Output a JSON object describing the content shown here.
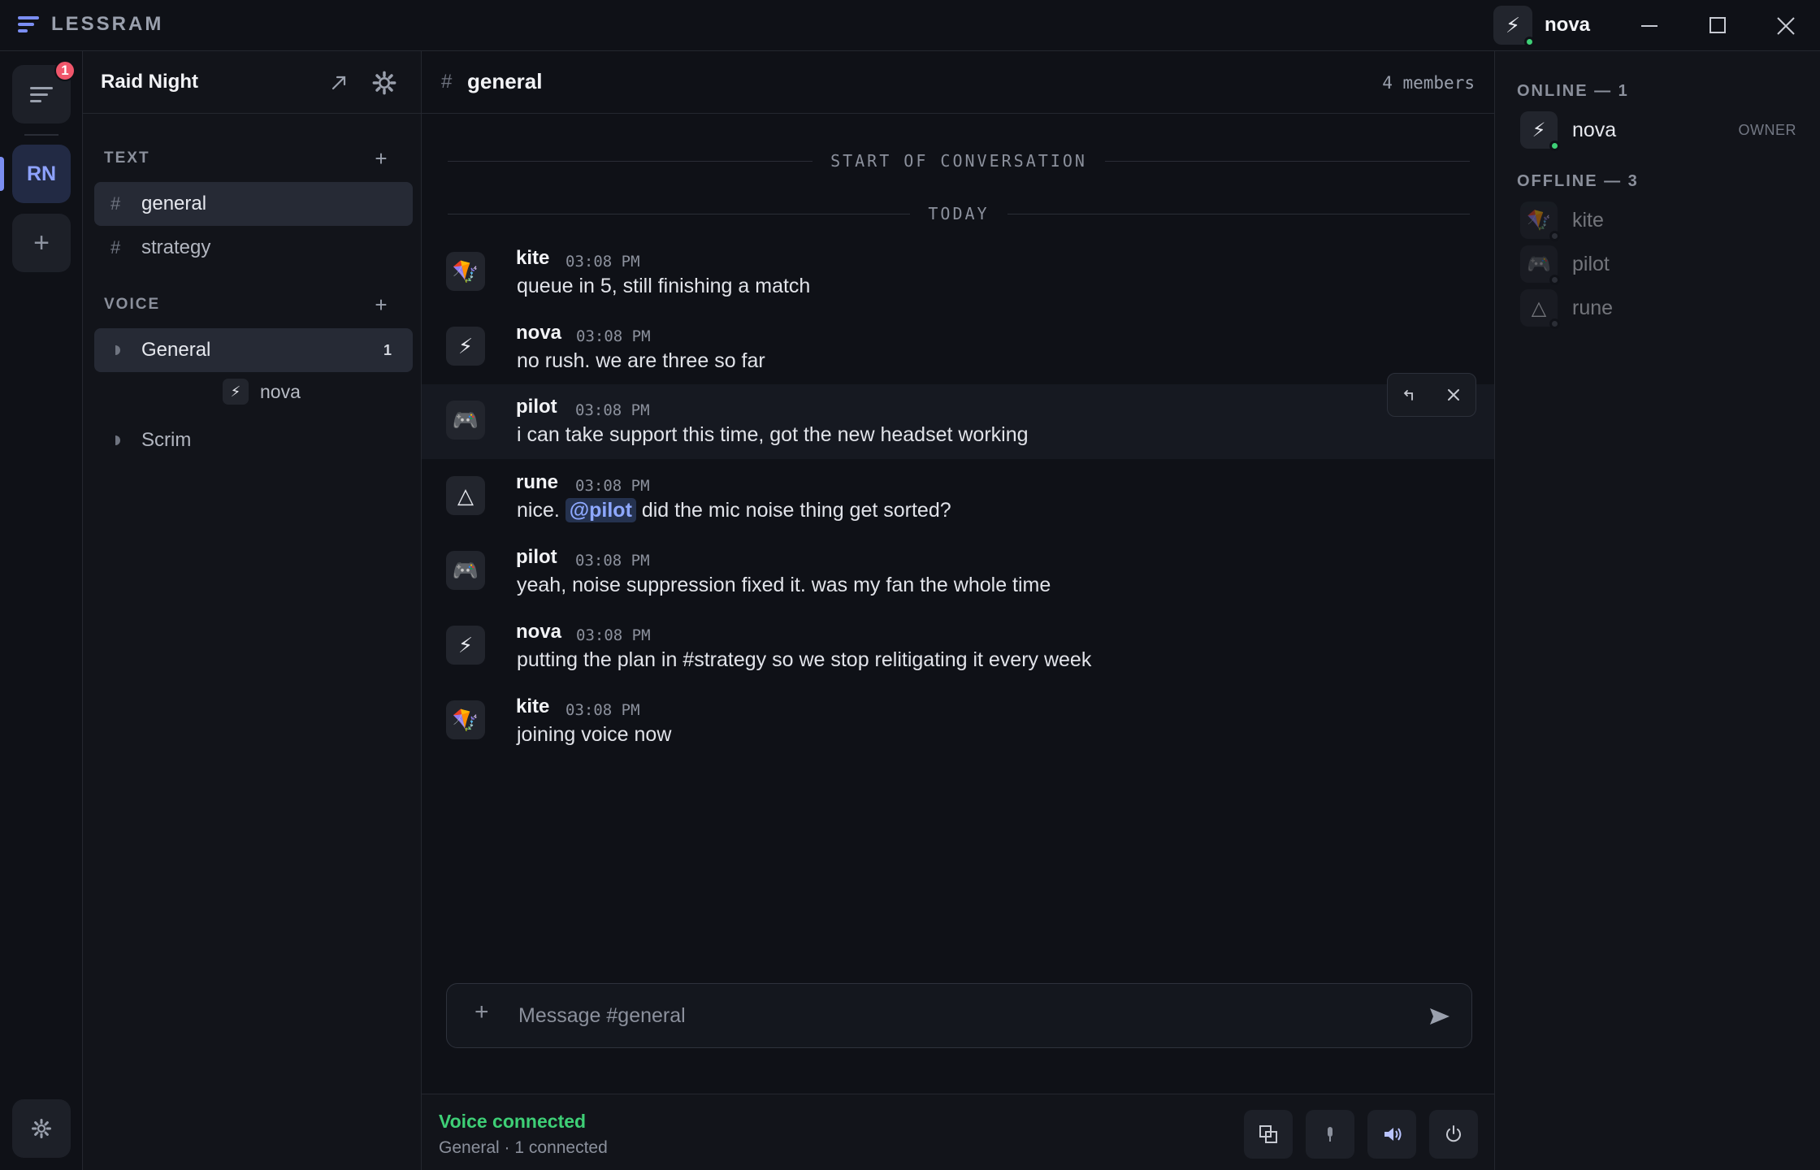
{
  "app": {
    "name": "LESSRAM"
  },
  "titlebar": {
    "user_name": "nova",
    "user_avatar_icon": "⚡",
    "accent": "#7b8ef2"
  },
  "rail": {
    "notification_count": "1",
    "server_initials": "RN",
    "add_label": "+"
  },
  "server": {
    "name": "Raid Night",
    "text_category": "TEXT",
    "voice_category": "VOICE",
    "text_channels": [
      {
        "name": "general",
        "active": true
      },
      {
        "name": "strategy",
        "active": false
      }
    ],
    "voice_channels": [
      {
        "name": "General",
        "count": "1",
        "active": true
      },
      {
        "name": "Scrim",
        "count": "",
        "active": false
      }
    ],
    "voice_members": [
      {
        "name": "nova"
      }
    ]
  },
  "chat": {
    "channel": "general",
    "members_count": "4 members",
    "start_label": "START OF CONVERSATION",
    "today_label": "TODAY",
    "messages": [
      {
        "author": "kite",
        "time": "03:08 PM",
        "text": "queue in 5, still finishing a match",
        "avatar": "🪁"
      },
      {
        "author": "nova",
        "time": "03:08 PM",
        "text": "no rush. we are three so far",
        "avatar": "⚡"
      },
      {
        "author": "pilot",
        "time": "03:08 PM",
        "text": "i can take support this time, got the new headset working",
        "avatar": "🎮"
      },
      {
        "author": "rune",
        "time": "03:08 PM",
        "text_before": "nice. ",
        "mention": "@pilot",
        "text_after": " did the mic noise thing get sorted?",
        "avatar": "△"
      },
      {
        "author": "pilot",
        "time": "03:08 PM",
        "text": "yeah, noise suppression fixed it. was my fan the whole time",
        "avatar": "🎮"
      },
      {
        "author": "nova",
        "time": "03:08 PM",
        "text": "putting the plan in #strategy so we stop relitigating it every week",
        "avatar": "⚡"
      },
      {
        "author": "kite",
        "time": "03:08 PM",
        "text": "joining voice now",
        "avatar": "🪁"
      }
    ],
    "composer": {
      "plus": "+",
      "placeholder": "Message #general"
    }
  },
  "voice_bar": {
    "status": "Voice connected",
    "sub": "General · 1 connected",
    "status_color": "#3ecf76"
  },
  "members": {
    "online_header": "ONLINE — 1",
    "offline_header": "OFFLINE — 3",
    "online": [
      {
        "name": "nova",
        "role": "OWNER",
        "avatar": "⚡"
      }
    ],
    "offline": [
      {
        "name": "kite",
        "avatar": "🪁"
      },
      {
        "name": "pilot",
        "avatar": "🎮"
      },
      {
        "name": "rune",
        "avatar": "△"
      }
    ]
  }
}
